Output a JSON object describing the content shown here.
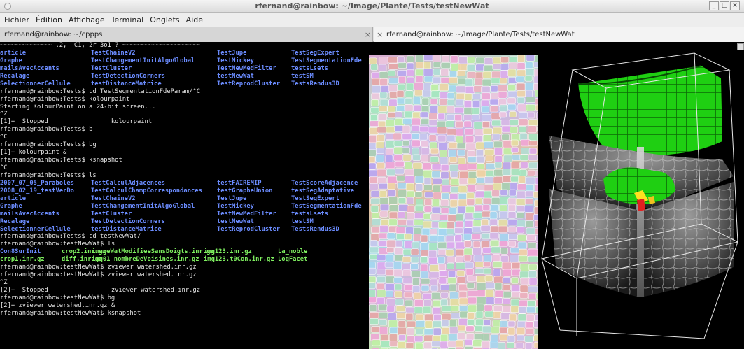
{
  "window": {
    "title": "rfernand@rainbow: ~/Image/Plante/Tests/testNewWat",
    "controls": [
      "_",
      "□",
      "×"
    ]
  },
  "menu": [
    "Fichier",
    "Édition",
    "Affichage",
    "Terminal",
    "Onglets",
    "Aide"
  ],
  "tabs": [
    {
      "label": "rfernand@rainbow: ~/cppps",
      "close": "×"
    },
    {
      "label": "rfernand@rainbow: ~/Image/Plante/Tests/testNewWat",
      "close": "×"
    }
  ],
  "terminal": {
    "top_line": "~~~~~~~~~~~~~~ .2,  C1, 2r 3o1 ? ~~~~~~~~~~~~~~~~~~~~~",
    "ls1": [
      [
        "article",
        "TestChaineV2",
        "TestJupe",
        "TestSegExpert"
      ],
      [
        "Graphe",
        "TestChangementInitAlgoGlobal",
        "TestMickey",
        "TestSegmentationFde"
      ],
      [
        "mailsAvecAccents",
        "TestCluster",
        "TestNewMedFilter",
        "testsLsets"
      ],
      [
        "Recalage",
        "TestDetectionCorners",
        "testNewWat",
        "testSM"
      ],
      [
        "SelectionnerCellule",
        "testDistanceMatrice",
        "TestReprodCluster",
        "TestsRendus3D"
      ]
    ],
    "block1": [
      "rfernand@rainbow:Tests$ cd TestSegmentationFdeParam/^C",
      "rfernand@rainbow:Tests$ kolourpaint",
      "Starting KolourPaint on a 24-bit screen...",
      "^Z",
      "[1]+  Stopped                 kolourpaint",
      "rfernand@rainbow:Tests$ b",
      "^C",
      "rfernand@rainbow:Tests$ bg",
      "[1]+ kolourpaint &",
      "rfernand@rainbow:Tests$ ksnapshot",
      "^C",
      "rfernand@rainbow:Tests$ ls"
    ],
    "ls2": [
      [
        "2007_07_05_Paraboles",
        "TestCalculAdjacences",
        "testFAIREMIP",
        "TestScoreAdjacence"
      ],
      [
        "2008_02_19_testVerDo",
        "TestCalculChampCorrespondances",
        "testGrapheUnion",
        "testSegAdaptative"
      ],
      [
        "article",
        "TestChaineV2",
        "TestJupe",
        "TestSegExpert"
      ],
      [
        "Graphe",
        "TestChangementInitAlgoGlobal",
        "TestMickey",
        "TestSegmentationFde"
      ],
      [
        "mailsAvecAccents",
        "TestCluster",
        "TestNewMedFilter",
        "testsLsets"
      ],
      [
        "Recalage",
        "TestDetectionCorners",
        "testNewWat",
        "testSM"
      ],
      [
        "SelectionnerCellule",
        "testDistanceMatrice",
        "TestReprodCluster",
        "TestsRendus3D"
      ]
    ],
    "block2": [
      "rfernand@rainbow:Tests$ cd testNewWat/",
      "rfernand@rainbow:testNewWat$ ls"
    ],
    "ls3": [
      [
        "Con8SurInit",
        "crop2.inr.gz",
        "imageWatModifieeSansDoigts.inr.gz",
        "img123.inr.gz",
        "La_noble"
      ],
      [
        "crop1.inr.gz",
        "diff.inr.gz",
        "img01_nombreDeVoisines.inr.gz",
        "img123.t0Con.inr.gz",
        "LogFacet"
      ]
    ],
    "block3": [
      "rfernand@rainbow:testNewWat$ zviewer watershed.inr.gz",
      "rfernand@rainbow:testNewWat$ zviewer watershed.inr.gz",
      "^Z",
      "[2]+  Stopped                 zviewer watershed.inr.gz",
      "rfernand@rainbow:testNewWat$ bg",
      "[2]+ zviewer watershed.inr.gz &",
      "rfernand@rainbow:testNewWat$ ksnapshot"
    ]
  },
  "colors": {
    "dir": "#6b8cff",
    "file": "#7ff060",
    "text": "#e6e6e6",
    "cell_green": "#33dd22"
  }
}
